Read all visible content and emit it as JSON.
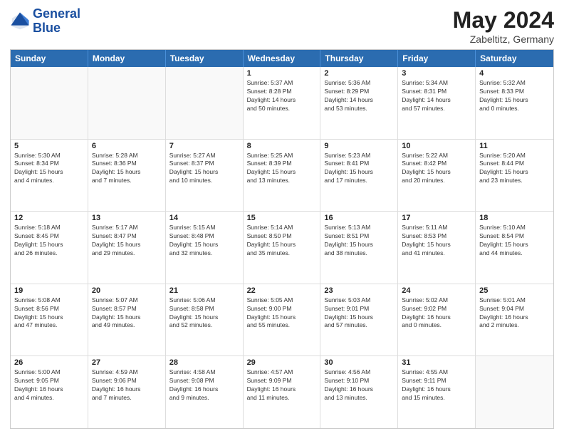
{
  "header": {
    "logo_line1": "General",
    "logo_line2": "Blue",
    "month": "May 2024",
    "location": "Zabeltitz, Germany"
  },
  "weekdays": [
    "Sunday",
    "Monday",
    "Tuesday",
    "Wednesday",
    "Thursday",
    "Friday",
    "Saturday"
  ],
  "rows": [
    [
      {
        "day": "",
        "info": ""
      },
      {
        "day": "",
        "info": ""
      },
      {
        "day": "",
        "info": ""
      },
      {
        "day": "1",
        "info": "Sunrise: 5:37 AM\nSunset: 8:28 PM\nDaylight: 14 hours\nand 50 minutes."
      },
      {
        "day": "2",
        "info": "Sunrise: 5:36 AM\nSunset: 8:29 PM\nDaylight: 14 hours\nand 53 minutes."
      },
      {
        "day": "3",
        "info": "Sunrise: 5:34 AM\nSunset: 8:31 PM\nDaylight: 14 hours\nand 57 minutes."
      },
      {
        "day": "4",
        "info": "Sunrise: 5:32 AM\nSunset: 8:33 PM\nDaylight: 15 hours\nand 0 minutes."
      }
    ],
    [
      {
        "day": "5",
        "info": "Sunrise: 5:30 AM\nSunset: 8:34 PM\nDaylight: 15 hours\nand 4 minutes."
      },
      {
        "day": "6",
        "info": "Sunrise: 5:28 AM\nSunset: 8:36 PM\nDaylight: 15 hours\nand 7 minutes."
      },
      {
        "day": "7",
        "info": "Sunrise: 5:27 AM\nSunset: 8:37 PM\nDaylight: 15 hours\nand 10 minutes."
      },
      {
        "day": "8",
        "info": "Sunrise: 5:25 AM\nSunset: 8:39 PM\nDaylight: 15 hours\nand 13 minutes."
      },
      {
        "day": "9",
        "info": "Sunrise: 5:23 AM\nSunset: 8:41 PM\nDaylight: 15 hours\nand 17 minutes."
      },
      {
        "day": "10",
        "info": "Sunrise: 5:22 AM\nSunset: 8:42 PM\nDaylight: 15 hours\nand 20 minutes."
      },
      {
        "day": "11",
        "info": "Sunrise: 5:20 AM\nSunset: 8:44 PM\nDaylight: 15 hours\nand 23 minutes."
      }
    ],
    [
      {
        "day": "12",
        "info": "Sunrise: 5:18 AM\nSunset: 8:45 PM\nDaylight: 15 hours\nand 26 minutes."
      },
      {
        "day": "13",
        "info": "Sunrise: 5:17 AM\nSunset: 8:47 PM\nDaylight: 15 hours\nand 29 minutes."
      },
      {
        "day": "14",
        "info": "Sunrise: 5:15 AM\nSunset: 8:48 PM\nDaylight: 15 hours\nand 32 minutes."
      },
      {
        "day": "15",
        "info": "Sunrise: 5:14 AM\nSunset: 8:50 PM\nDaylight: 15 hours\nand 35 minutes."
      },
      {
        "day": "16",
        "info": "Sunrise: 5:13 AM\nSunset: 8:51 PM\nDaylight: 15 hours\nand 38 minutes."
      },
      {
        "day": "17",
        "info": "Sunrise: 5:11 AM\nSunset: 8:53 PM\nDaylight: 15 hours\nand 41 minutes."
      },
      {
        "day": "18",
        "info": "Sunrise: 5:10 AM\nSunset: 8:54 PM\nDaylight: 15 hours\nand 44 minutes."
      }
    ],
    [
      {
        "day": "19",
        "info": "Sunrise: 5:08 AM\nSunset: 8:56 PM\nDaylight: 15 hours\nand 47 minutes."
      },
      {
        "day": "20",
        "info": "Sunrise: 5:07 AM\nSunset: 8:57 PM\nDaylight: 15 hours\nand 49 minutes."
      },
      {
        "day": "21",
        "info": "Sunrise: 5:06 AM\nSunset: 8:58 PM\nDaylight: 15 hours\nand 52 minutes."
      },
      {
        "day": "22",
        "info": "Sunrise: 5:05 AM\nSunset: 9:00 PM\nDaylight: 15 hours\nand 55 minutes."
      },
      {
        "day": "23",
        "info": "Sunrise: 5:03 AM\nSunset: 9:01 PM\nDaylight: 15 hours\nand 57 minutes."
      },
      {
        "day": "24",
        "info": "Sunrise: 5:02 AM\nSunset: 9:02 PM\nDaylight: 16 hours\nand 0 minutes."
      },
      {
        "day": "25",
        "info": "Sunrise: 5:01 AM\nSunset: 9:04 PM\nDaylight: 16 hours\nand 2 minutes."
      }
    ],
    [
      {
        "day": "26",
        "info": "Sunrise: 5:00 AM\nSunset: 9:05 PM\nDaylight: 16 hours\nand 4 minutes."
      },
      {
        "day": "27",
        "info": "Sunrise: 4:59 AM\nSunset: 9:06 PM\nDaylight: 16 hours\nand 7 minutes."
      },
      {
        "day": "28",
        "info": "Sunrise: 4:58 AM\nSunset: 9:08 PM\nDaylight: 16 hours\nand 9 minutes."
      },
      {
        "day": "29",
        "info": "Sunrise: 4:57 AM\nSunset: 9:09 PM\nDaylight: 16 hours\nand 11 minutes."
      },
      {
        "day": "30",
        "info": "Sunrise: 4:56 AM\nSunset: 9:10 PM\nDaylight: 16 hours\nand 13 minutes."
      },
      {
        "day": "31",
        "info": "Sunrise: 4:55 AM\nSunset: 9:11 PM\nDaylight: 16 hours\nand 15 minutes."
      },
      {
        "day": "",
        "info": ""
      }
    ]
  ]
}
